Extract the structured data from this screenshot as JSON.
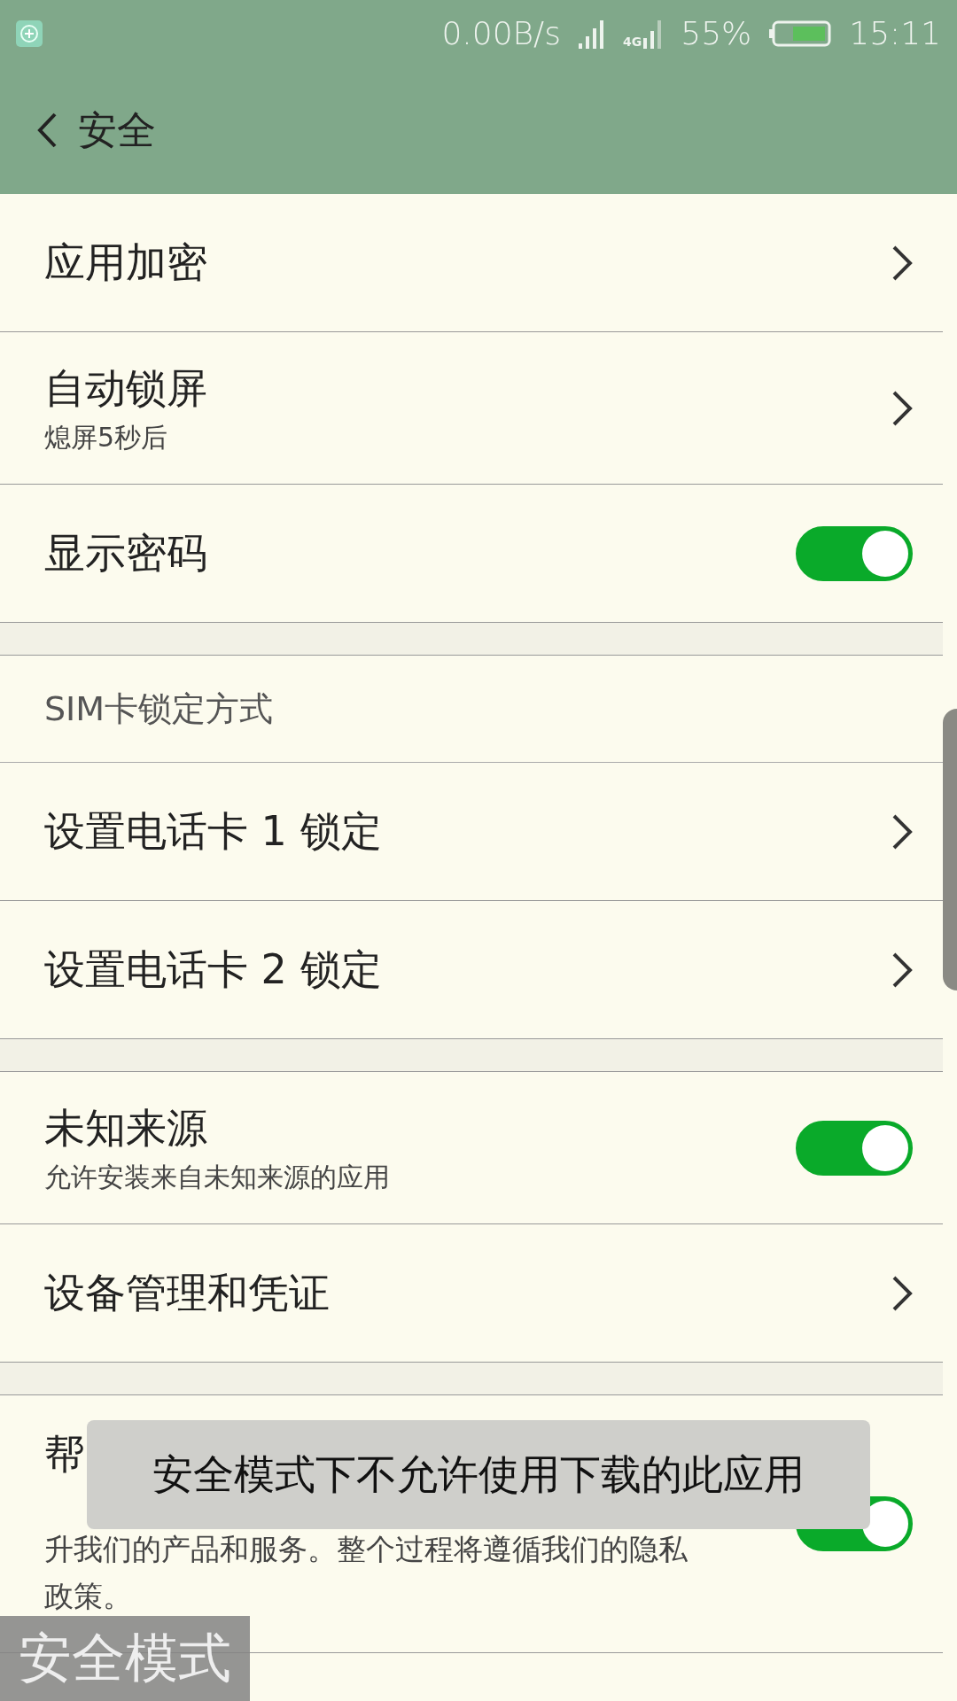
{
  "status_bar": {
    "speed": "0.00B/s",
    "network": "4G",
    "battery": "55%",
    "time": "15:11"
  },
  "header": {
    "title": "安全"
  },
  "sections": [
    {
      "items": [
        {
          "kind": "link",
          "title": "应用加密"
        },
        {
          "kind": "link",
          "title": "自动锁屏",
          "subtitle": "熄屏5秒后"
        },
        {
          "kind": "toggle",
          "title": "显示密码",
          "on": true
        }
      ]
    },
    {
      "header": "SIM卡锁定方式",
      "items": [
        {
          "kind": "link",
          "title": "设置电话卡 1 锁定"
        },
        {
          "kind": "link",
          "title": "设置电话卡 2 锁定"
        }
      ]
    },
    {
      "items": [
        {
          "kind": "toggle",
          "title": "未知来源",
          "subtitle": "允许安装来自未知来源的应用",
          "on": true
        },
        {
          "kind": "link",
          "title": "设备管理和凭证"
        }
      ]
    },
    {
      "items": [
        {
          "kind": "toggle",
          "title": "帮",
          "subtitle": "升我们的产品和服务。整个过程将遵循我们的隐私政策。",
          "on": true,
          "tall": true
        }
      ]
    }
  ],
  "toast": "安全模式下不允许使用下载的此应用",
  "mode_badge": "安全模式"
}
